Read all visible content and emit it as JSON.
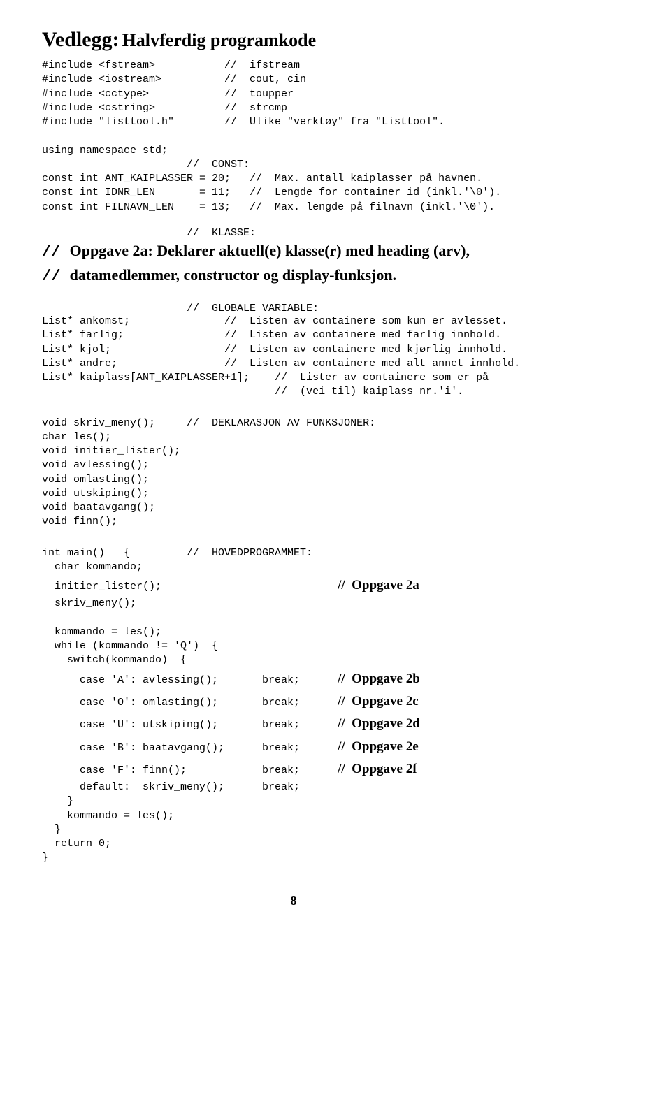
{
  "heading": {
    "prefix": "Vedlegg:",
    "title": "Halvferdig programkode"
  },
  "block1": "#include <fstream>           //  ifstream\n#include <iostream>          //  cout, cin\n#include <cctype>            //  toupper\n#include <cstring>           //  strcmp\n#include \"listtool.h\"        //  Ulike \"verktøy\" fra \"Listtool\".\n\nusing namespace std;\n                       //  CONST:\nconst int ANT_KAIPLASSER = 20;   //  Max. antall kaiplasser på havnen.\nconst int IDNR_LEN       = 11;   //  Lengde for container id (inkl.'\\0').\nconst int FILNAVN_LEN    = 13;   //  Max. lengde på filnavn (inkl.'\\0').",
  "klasse_comment": "                       //  KLASSE:",
  "oppgave2a": {
    "line1_prefix": "//   ",
    "line1_text": "Oppgave 2a:  Deklarer aktuell(e) klasse(r) med heading (arv),",
    "line2_prefix": "//                           ",
    "line2_text": "datamedlemmer, constructor og display-funksjon."
  },
  "globale_comment": "                       //  GLOBALE VARIABLE:",
  "block2": "List* ankomst;               //  Listen av containere som kun er avlesset.\nList* farlig;                //  Listen av containere med farlig innhold.\nList* kjol;                  //  Listen av containere med kjørlig innhold.\nList* andre;                 //  Listen av containere med alt annet innhold.\nList* kaiplass[ANT_KAIPLASSER+1];    //  Lister av containere som er på\n                                     //  (vei til) kaiplass nr.'i'.",
  "block3": "void skriv_meny();     //  DEKLARASJON AV FUNKSJONER:\nchar les();\nvoid initier_lister();\nvoid avlessing();\nvoid omlasting();\nvoid utskiping();\nvoid baatavgang();\nvoid finn();",
  "block4": "int main()   {         //  HOVEDPROGRAMMET:\n  char kommando;\n",
  "initier_line": "  initier_lister();                            ",
  "initier_label": "//  Oppgave 2a",
  "block5": "  skriv_meny();\n\n  kommando = les();\n  while (kommando != 'Q')  {\n    switch(kommando)  {",
  "cases": [
    {
      "code": "      case 'A': avlessing();       break;      ",
      "label": "//  Oppgave 2b"
    },
    {
      "code": "      case 'O': omlasting();       break;      ",
      "label": "//  Oppgave 2c"
    },
    {
      "code": "      case 'U': utskiping();       break;      ",
      "label": "//  Oppgave 2d"
    },
    {
      "code": "      case 'B': baatavgang();      break;      ",
      "label": "//  Oppgave 2e"
    },
    {
      "code": "      case 'F': finn();            break;      ",
      "label": "//  Oppgave 2f"
    }
  ],
  "block6": "      default:  skriv_meny();      break;\n    }\n    kommando = les();\n  }\n  return 0;\n}",
  "page_number": "8"
}
